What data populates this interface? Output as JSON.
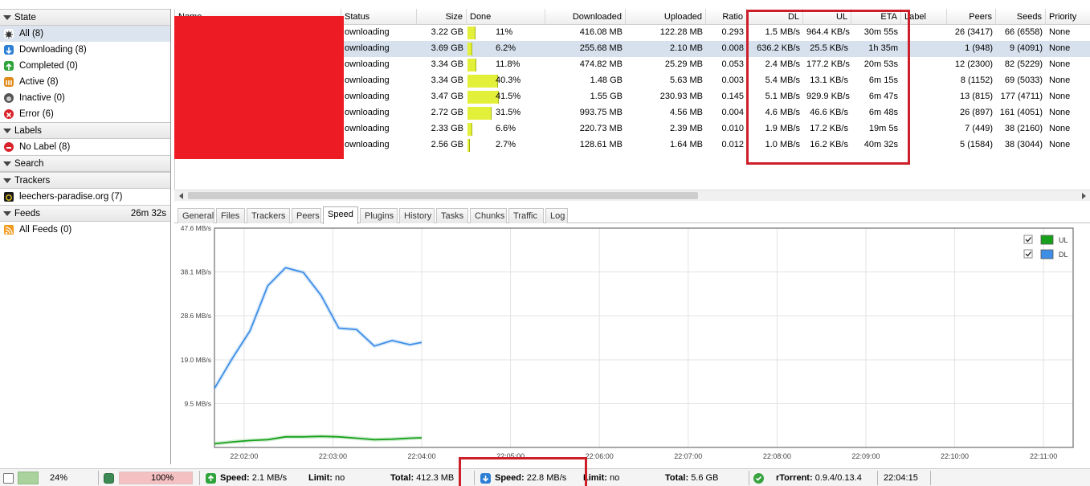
{
  "sidebar": {
    "state_header": "State",
    "state_items": [
      {
        "label": "All (8)",
        "icon": "all-icon"
      },
      {
        "label": "Downloading (8)",
        "icon": "downloading-icon"
      },
      {
        "label": "Completed (0)",
        "icon": "completed-icon"
      },
      {
        "label": "Active (8)",
        "icon": "active-icon"
      },
      {
        "label": "Inactive (0)",
        "icon": "inactive-icon"
      },
      {
        "label": "Error (6)",
        "icon": "error-icon"
      }
    ],
    "labels_header": "Labels",
    "labels_items": [
      {
        "label": "No Label (8)",
        "icon": "no-label-icon"
      }
    ],
    "search_header": "Search",
    "trackers_header": "Trackers",
    "trackers_items": [
      {
        "label": "leechers-paradise.org (7)",
        "icon": "tracker-icon"
      }
    ],
    "feeds_header": "Feeds",
    "feeds_timer": "26m 32s",
    "feeds_items": [
      {
        "label": "All Feeds (0)",
        "icon": "rss-icon"
      }
    ]
  },
  "list": {
    "columns": {
      "name": "Name",
      "status": "Status",
      "size": "Size",
      "done": "Done",
      "downloaded": "Downloaded",
      "uploaded": "Uploaded",
      "ratio": "Ratio",
      "dl": "DL",
      "ul": "UL",
      "eta": "ETA",
      "label": "Label",
      "peers": "Peers",
      "seeds": "Seeds",
      "priority": "Priority"
    },
    "rows": [
      {
        "status": "ownloading",
        "size": "3.22 GB",
        "done": "11%",
        "progress": 0.11,
        "downloaded": "416.08 MB",
        "uploaded": "122.28 MB",
        "ratio": "0.293",
        "dl": "1.5 MB/s",
        "ul": "964.4 KB/s",
        "eta": "30m 55s",
        "label": "",
        "peers": "26 (3417)",
        "seeds": "66 (6558)",
        "priority": "None"
      },
      {
        "status": "ownloading",
        "size": "3.69 GB",
        "done": "6.2%",
        "progress": 0.062,
        "downloaded": "255.68 MB",
        "uploaded": "2.10 MB",
        "ratio": "0.008",
        "dl": "636.2 KB/s",
        "ul": "25.5 KB/s",
        "eta": "1h 35m",
        "label": "",
        "peers": "1 (948)",
        "seeds": "9 (4091)",
        "priority": "None"
      },
      {
        "status": "ownloading",
        "size": "3.34 GB",
        "done": "11.8%",
        "progress": 0.118,
        "downloaded": "474.82 MB",
        "uploaded": "25.29 MB",
        "ratio": "0.053",
        "dl": "2.4 MB/s",
        "ul": "177.2 KB/s",
        "eta": "20m 53s",
        "label": "",
        "peers": "12 (2300)",
        "seeds": "82 (5229)",
        "priority": "None"
      },
      {
        "status": "ownloading",
        "size": "3.34 GB",
        "done": "40.3%",
        "progress": 0.403,
        "downloaded": "1.48 GB",
        "uploaded": "5.63 MB",
        "ratio": "0.003",
        "dl": "5.4 MB/s",
        "ul": "13.1 KB/s",
        "eta": "6m 15s",
        "label": "",
        "peers": "8 (1152)",
        "seeds": "69 (5033)",
        "priority": "None"
      },
      {
        "status": "ownloading",
        "size": "3.47 GB",
        "done": "41.5%",
        "progress": 0.415,
        "downloaded": "1.55 GB",
        "uploaded": "230.93 MB",
        "ratio": "0.145",
        "dl": "5.1 MB/s",
        "ul": "929.9 KB/s",
        "eta": "6m 47s",
        "label": "",
        "peers": "13 (815)",
        "seeds": "177 (4711)",
        "priority": "None"
      },
      {
        "status": "ownloading",
        "size": "2.72 GB",
        "done": "31.5%",
        "progress": 0.315,
        "downloaded": "993.75 MB",
        "uploaded": "4.56 MB",
        "ratio": "0.004",
        "dl": "4.6 MB/s",
        "ul": "46.6 KB/s",
        "eta": "6m 48s",
        "label": "",
        "peers": "26 (897)",
        "seeds": "161 (4051)",
        "priority": "None"
      },
      {
        "status": "ownloading",
        "size": "2.33 GB",
        "done": "6.6%",
        "progress": 0.066,
        "downloaded": "220.73 MB",
        "uploaded": "2.39 MB",
        "ratio": "0.010",
        "dl": "1.9 MB/s",
        "ul": "17.2 KB/s",
        "eta": "19m 5s",
        "label": "",
        "peers": "7 (449)",
        "seeds": "38 (2160)",
        "priority": "None"
      },
      {
        "status": "ownloading",
        "size": "2.56 GB",
        "done": "2.7%",
        "progress": 0.027,
        "downloaded": "128.61 MB",
        "uploaded": "1.64 MB",
        "ratio": "0.012",
        "dl": "1.0 MB/s",
        "ul": "16.2 KB/s",
        "eta": "40m 32s",
        "label": "",
        "peers": "5 (1584)",
        "seeds": "38 (3044)",
        "priority": "None"
      }
    ]
  },
  "tabs": [
    "General",
    "Files",
    "Trackers",
    "Peers",
    "Speed",
    "Plugins",
    "History",
    "Tasks",
    "Chunks",
    "Traffic",
    "Log"
  ],
  "active_tab": "Speed",
  "chart_data": {
    "type": "line",
    "y_ticks": [
      "47.6 MB/s",
      "38.1 MB/s",
      "28.6 MB/s",
      "19.0 MB/s",
      "9.5 MB/s"
    ],
    "y_tick_values": [
      47.6,
      38.1,
      28.6,
      19.0,
      9.5
    ],
    "x_ticks": [
      "22:02:00",
      "22:03:00",
      "22:04:00",
      "22:05:00",
      "22:06:00",
      "22:07:00",
      "22:08:00",
      "22:09:00",
      "22:10:00",
      "22:11:00"
    ],
    "x_range": [
      "22:01:40",
      "22:11:20"
    ],
    "ylim": [
      0,
      47.6
    ],
    "legend_position": "top-right",
    "series": [
      {
        "name": "UL",
        "color": "#17a11b",
        "times": [
          "22:01:40",
          "22:01:52",
          "22:02:04",
          "22:02:16",
          "22:02:28",
          "22:02:40",
          "22:02:52",
          "22:03:04",
          "22:03:16",
          "22:03:28",
          "22:03:40",
          "22:03:52",
          "22:04:00"
        ],
        "values": [
          0.8,
          1.2,
          1.5,
          1.7,
          2.3,
          2.3,
          2.4,
          2.3,
          2.0,
          1.7,
          1.8,
          2.0,
          2.1
        ]
      },
      {
        "name": "DL",
        "color": "#3e8ee6",
        "times": [
          "22:01:40",
          "22:01:52",
          "22:02:04",
          "22:02:16",
          "22:02:28",
          "22:02:40",
          "22:02:52",
          "22:03:04",
          "22:03:16",
          "22:03:28",
          "22:03:40",
          "22:03:52",
          "22:04:00"
        ],
        "values": [
          12.8,
          19.3,
          25.3,
          35.1,
          39.0,
          38.0,
          33.0,
          25.9,
          25.6,
          22.0,
          23.2,
          22.3,
          22.8
        ]
      }
    ]
  },
  "statusbar": {
    "disk_pct": "24%",
    "mem_pct": "100%",
    "mem_fill": 1.0,
    "ul_speed_label": "Speed:",
    "ul_speed": "2.1 MB/s",
    "ul_limit_label": "Limit:",
    "ul_limit": "no",
    "ul_total_label": "Total:",
    "ul_total": "412.3 MB",
    "dl_speed_label": "Speed:",
    "dl_speed": "22.8 MB/s",
    "dl_limit_label": "Limit:",
    "dl_limit": "no",
    "dl_total_label": "Total:",
    "dl_total": "5.6 GB",
    "client_label": "rTorrent:",
    "client_version": "0.9.4/0.13.4",
    "clock": "22:04:15"
  },
  "colors": {
    "accent": "#cc1f2a",
    "redaction": "#ed1c24",
    "progress": "#e3f03a",
    "ul_line": "#17a11b",
    "dl_line": "#3e8ee6"
  }
}
